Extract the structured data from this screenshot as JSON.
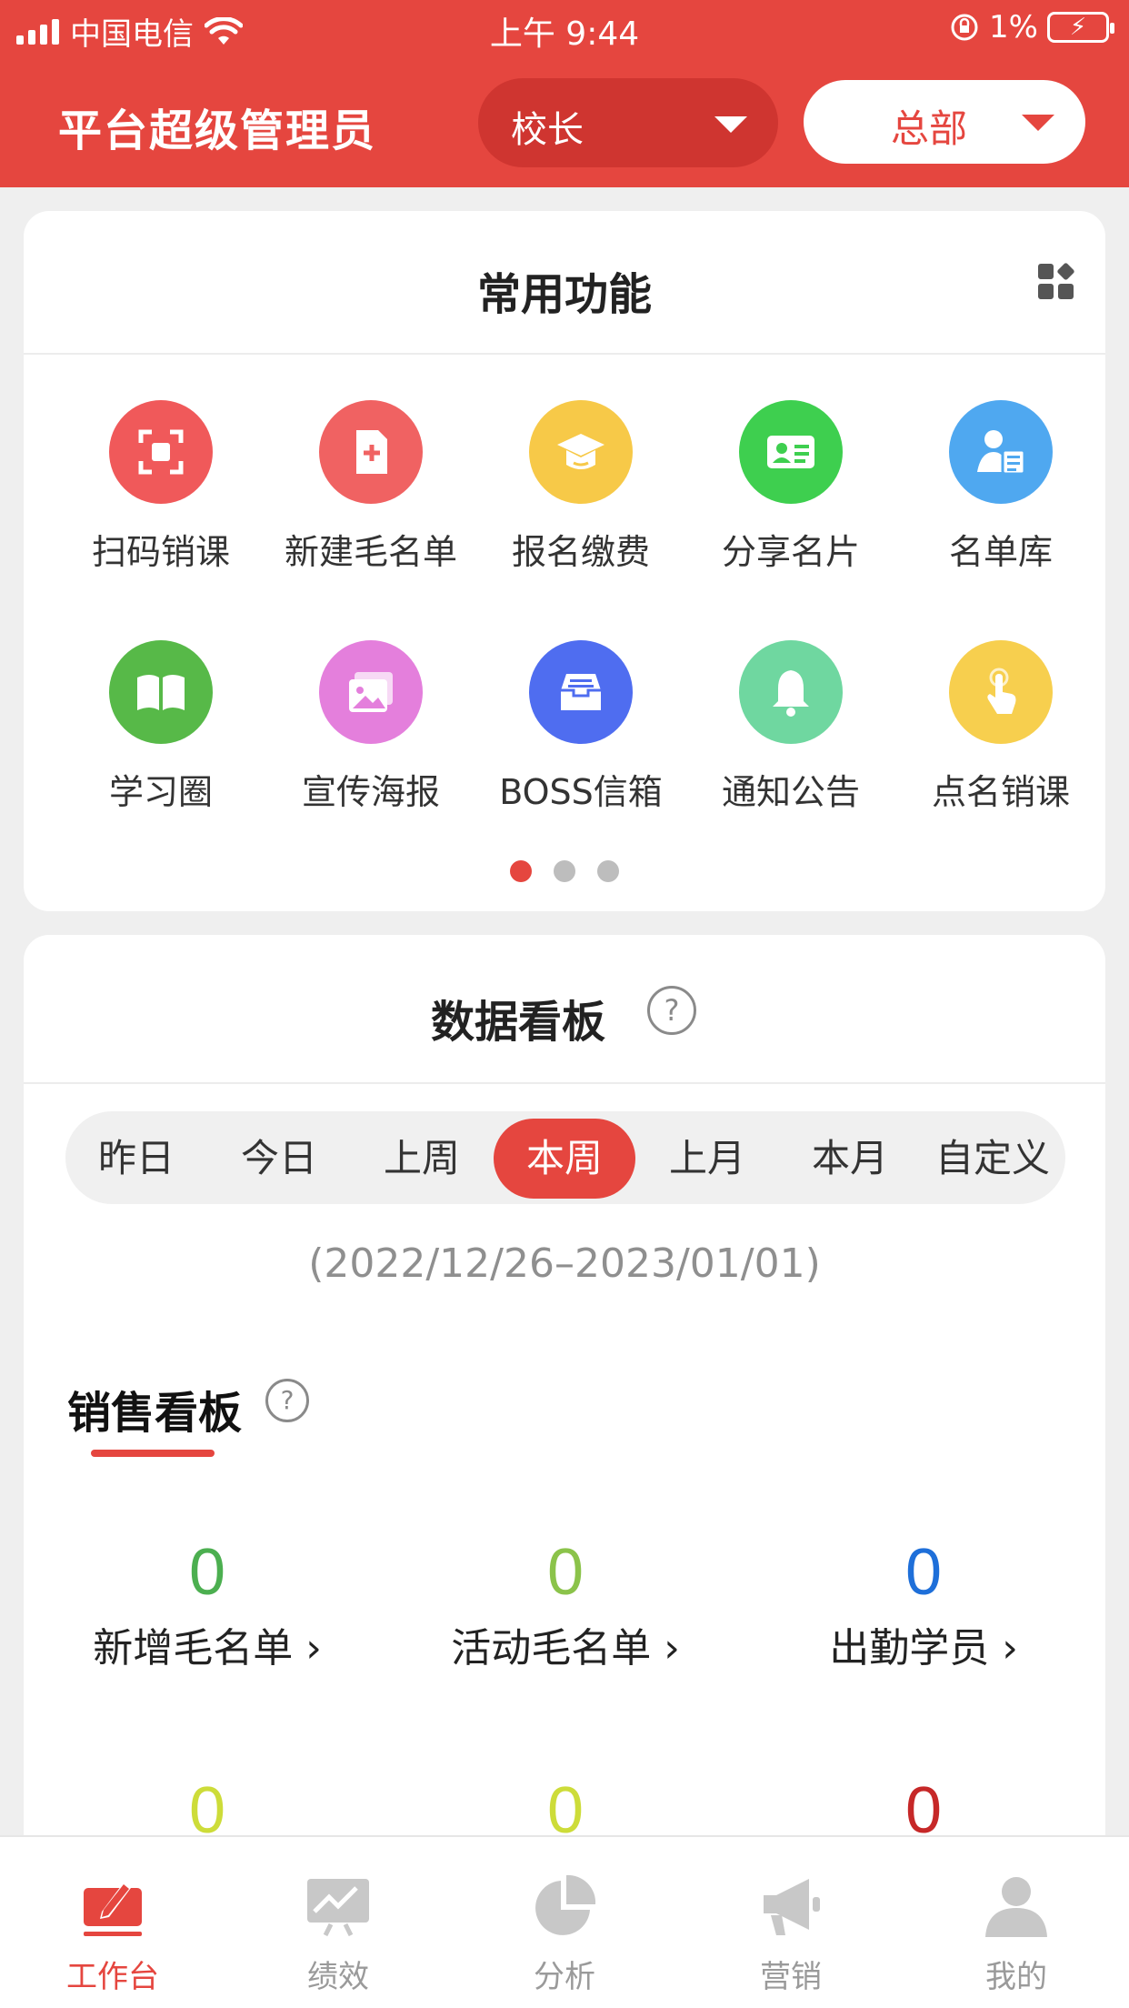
{
  "status_bar": {
    "carrier": "中国电信",
    "time": "上午 9:44",
    "battery_percent": "1%"
  },
  "header": {
    "title": "平台超级管理员",
    "role_select": "校长",
    "org_select": "总部",
    "accent_color": "#e5463f"
  },
  "functions": {
    "title": "常用功能",
    "items": [
      {
        "label": "扫码销课",
        "icon": "scan-icon",
        "color": "#f0595a"
      },
      {
        "label": "新建毛名单",
        "icon": "new-doc-icon",
        "color": "#f06262"
      },
      {
        "label": "报名缴费",
        "icon": "graduation-cap-icon",
        "color": "#f7c948"
      },
      {
        "label": "分享名片",
        "icon": "id-card-icon",
        "color": "#3ecf4f"
      },
      {
        "label": "名单库",
        "icon": "user-list-icon",
        "color": "#4fa8f0"
      },
      {
        "label": "学习圈",
        "icon": "book-icon",
        "color": "#57b948"
      },
      {
        "label": "宣传海报",
        "icon": "poster-icon",
        "color": "#e47fdc"
      },
      {
        "label": "BOSS信箱",
        "icon": "inbox-icon",
        "color": "#4f6df0"
      },
      {
        "label": "通知公告",
        "icon": "bell-icon",
        "color": "#6fd7a0"
      },
      {
        "label": "点名销课",
        "icon": "tap-icon",
        "color": "#f7cf4e"
      }
    ],
    "pages": 3,
    "active_page": 1
  },
  "dashboard": {
    "title": "数据看板",
    "help": "?",
    "tabs": [
      "昨日",
      "今日",
      "上周",
      "本周",
      "上月",
      "本月",
      "自定义"
    ],
    "active_tab": "本周",
    "date_range": "(2022/12/26–2023/01/01)",
    "sales": {
      "title": "销售看板",
      "help": "?",
      "metrics": [
        {
          "value": "0",
          "label": "新增毛名单 ›",
          "color": "#4caf50"
        },
        {
          "value": "0",
          "label": "活动毛名单 ›",
          "color": "#8bc34a"
        },
        {
          "value": "0",
          "label": "出勤学员 ›",
          "color": "#1e6fd9"
        },
        {
          "value": "0",
          "label": "",
          "color": "#cddc39"
        },
        {
          "value": "0",
          "label": "",
          "color": "#cddc39"
        },
        {
          "value": "0",
          "label": "",
          "color": "#c62828"
        }
      ]
    }
  },
  "bottom_nav": {
    "items": [
      {
        "label": "工作台",
        "icon": "workbench-icon",
        "active": true
      },
      {
        "label": "绩效",
        "icon": "performance-chart-icon",
        "active": false
      },
      {
        "label": "分析",
        "icon": "pie-chart-icon",
        "active": false
      },
      {
        "label": "营销",
        "icon": "megaphone-icon",
        "active": false
      },
      {
        "label": "我的",
        "icon": "profile-icon",
        "active": false
      }
    ]
  }
}
